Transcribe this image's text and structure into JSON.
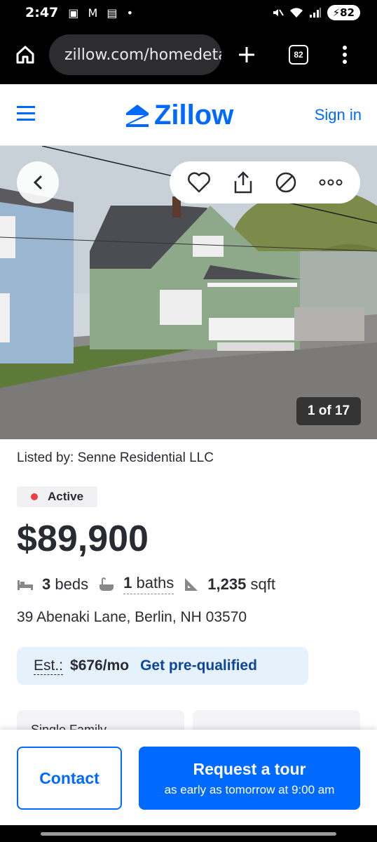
{
  "status_bar": {
    "time": "2:47",
    "left_icons": "▣ M ▤ •",
    "battery": "82",
    "signal_label": "5"
  },
  "browser": {
    "url": "zillow.com/homedetails",
    "tab_count": "82",
    "icons": [
      "home-icon",
      "site-settings-icon",
      "new-tab-plus-icon",
      "tab-switcher-icon",
      "more-vertical-icon"
    ]
  },
  "header": {
    "logo_text": "Zillow",
    "sign_in": "Sign in"
  },
  "photo": {
    "counter": "1 of 17"
  },
  "listing": {
    "listed_by": "Listed by: Senne Residential LLC",
    "status": "Active",
    "price": "$89,900",
    "beds_value": "3",
    "beds_label": "beds",
    "baths_value": "1",
    "baths_label": "baths",
    "sqft_value": "1,235",
    "sqft_label": "sqft",
    "address": "39 Abenaki Lane, Berlin, NH 03570",
    "est_label": "Est.:",
    "est_value": "$676/mo",
    "prequal": "Get pre-qualified",
    "card_1": "Single Family",
    "card_2": ""
  },
  "cta": {
    "contact": "Contact",
    "tour_title": "Request a tour",
    "tour_sub": "as early as tomorrow at 9:00 am"
  },
  "colors": {
    "brand_blue": "#006aff",
    "active_dot": "#e8413f",
    "est_bg": "#e6f2fb"
  }
}
